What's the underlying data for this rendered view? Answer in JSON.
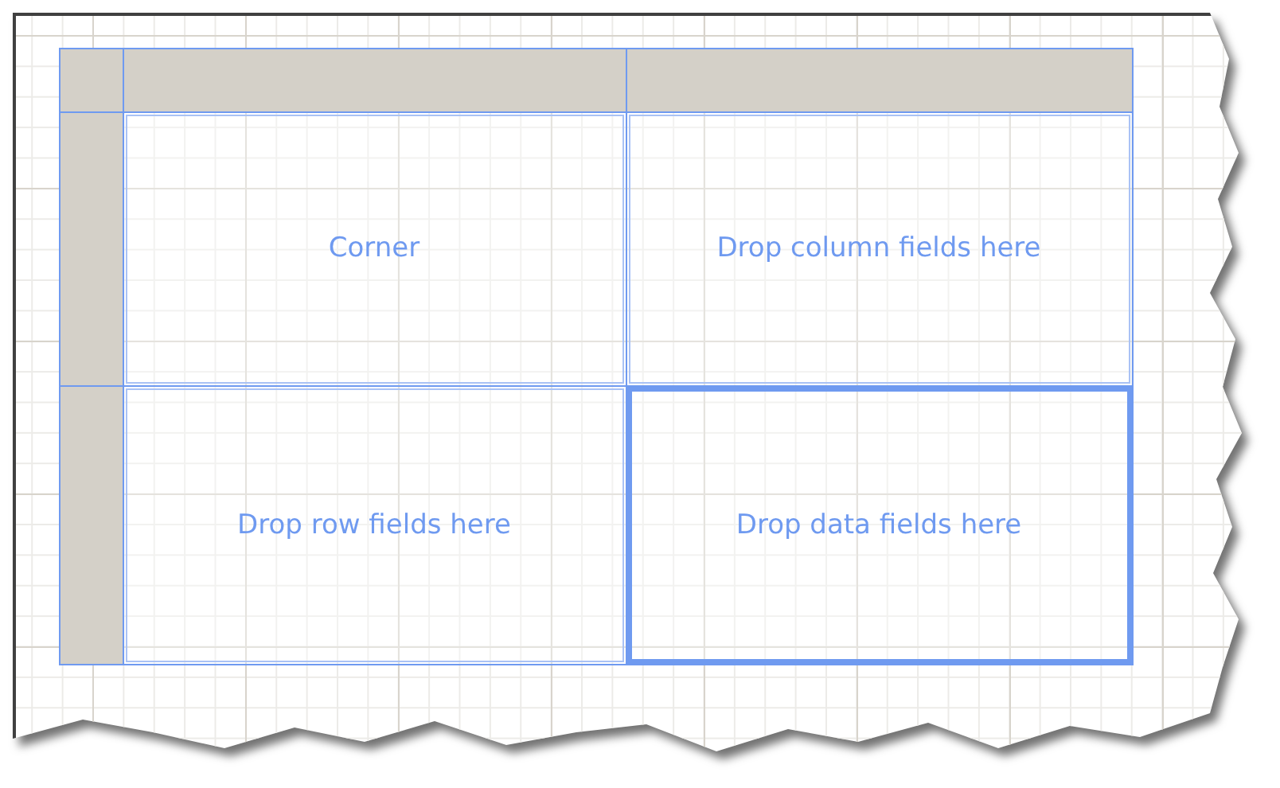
{
  "matrix": {
    "cells": [
      {
        "label": "Corner",
        "selected": false
      },
      {
        "label": "Drop column fields here",
        "selected": false
      },
      {
        "label": "Drop row fields here",
        "selected": false
      },
      {
        "label": "Drop data fields here",
        "selected": true
      }
    ]
  }
}
